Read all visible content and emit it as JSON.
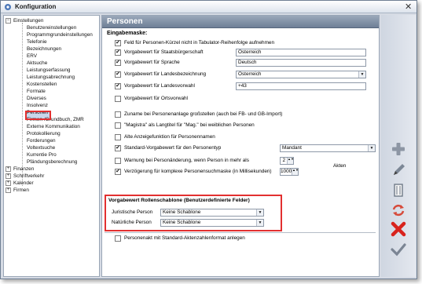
{
  "window": {
    "title": "Konfiguration",
    "close_glyph": "✕"
  },
  "tree": {
    "root_expanded": {
      "label": "Einstellungen",
      "glyph": "−"
    },
    "children": [
      "Benutzereinstellungen",
      "Programmgrundeinstellungen",
      "Telefonie",
      "Bezeichnungen",
      "ERV",
      "Aktsuche",
      "Leistungserfassung",
      "Leistungsabrechnung",
      "Kostenstellen",
      "Formate",
      "Diverses",
      "Insolvenz",
      "Personen",
      "Firmen-/Grundbuch, ZMR",
      "Externe Kommunikation",
      "Protokollierung",
      "Forderungen",
      "Voltextsuche",
      "Kurrentie Pro",
      "Pfändungsberechnung"
    ],
    "collapsed": [
      {
        "label": "Finanzen",
        "glyph": "+"
      },
      {
        "label": "Schriftverkehr",
        "glyph": "+"
      },
      {
        "label": "Kalender",
        "glyph": "+"
      },
      {
        "label": "Firmen",
        "glyph": "+"
      }
    ],
    "selected": "Personen"
  },
  "panel": {
    "title": "Personen",
    "section": "Eingabemaske:",
    "check_glyph": "✔",
    "options": [
      {
        "label": "Feld für Personen-Kürzel nicht in Tabulator-Reihenfolge aufnehmen",
        "checked": true
      },
      {
        "label": "Vorgabewert für Staatsbürgerschaft",
        "checked": true,
        "value": "Österreich"
      },
      {
        "label": "Vorgabewert für Sprache",
        "checked": true,
        "value": "Deutsch"
      },
      {
        "label": "Vorgabewert für Landesbezeichnung",
        "checked": true,
        "value": "Österreich"
      },
      {
        "label": "Vorgabewert für Landesvorwahl",
        "checked": true,
        "value": "+43"
      },
      {
        "label": "Vorgabewert für Ortsvorwahl",
        "checked": false
      },
      {
        "label": "Zuname bei Personenanlage großstellen (auch bei FB- und GB-Import)",
        "checked": false
      },
      {
        "label": "\"Magistra\" als Langtitel für \"Mag.\" bei weiblichen Personen",
        "checked": false
      },
      {
        "label": "Alte Anzeigefunktion für Personennamen",
        "checked": false
      },
      {
        "label": "Standard-Vorgabewert für den Personentyp",
        "checked": true,
        "value": "Mandant"
      },
      {
        "label": "Warnung bei Personänderung, wenn Person in mehr als",
        "checked": false,
        "value": "2",
        "suffix": "Akten"
      },
      {
        "label": "Verzögerung für komplexe Personensuchmaske (in Millisekunden)",
        "checked": true,
        "value": "1000"
      }
    ],
    "group": {
      "title": "Vorgabewert Rollenschablone (Benutzerdefinierte Felder)",
      "rows": [
        {
          "label": "Juristische Person",
          "value": "Keine Schablone"
        },
        {
          "label": "Natürliche Person",
          "value": "Keine Schablone"
        }
      ]
    },
    "footer_option": {
      "label": "Personenakt mit Standard-Aktenzahlenformat anlegen",
      "checked": false
    },
    "dropdown_glyph": "▼",
    "spin_glyph": "▲▼"
  },
  "toolbar": {
    "icons": [
      "add-icon",
      "edit-icon",
      "delete-icon",
      "refresh-icon",
      "cancel-icon",
      "confirm-icon"
    ]
  },
  "colors": {
    "header": "#7f8ea4",
    "highlight": "#e23030",
    "toolbar": "#d8dee8"
  }
}
